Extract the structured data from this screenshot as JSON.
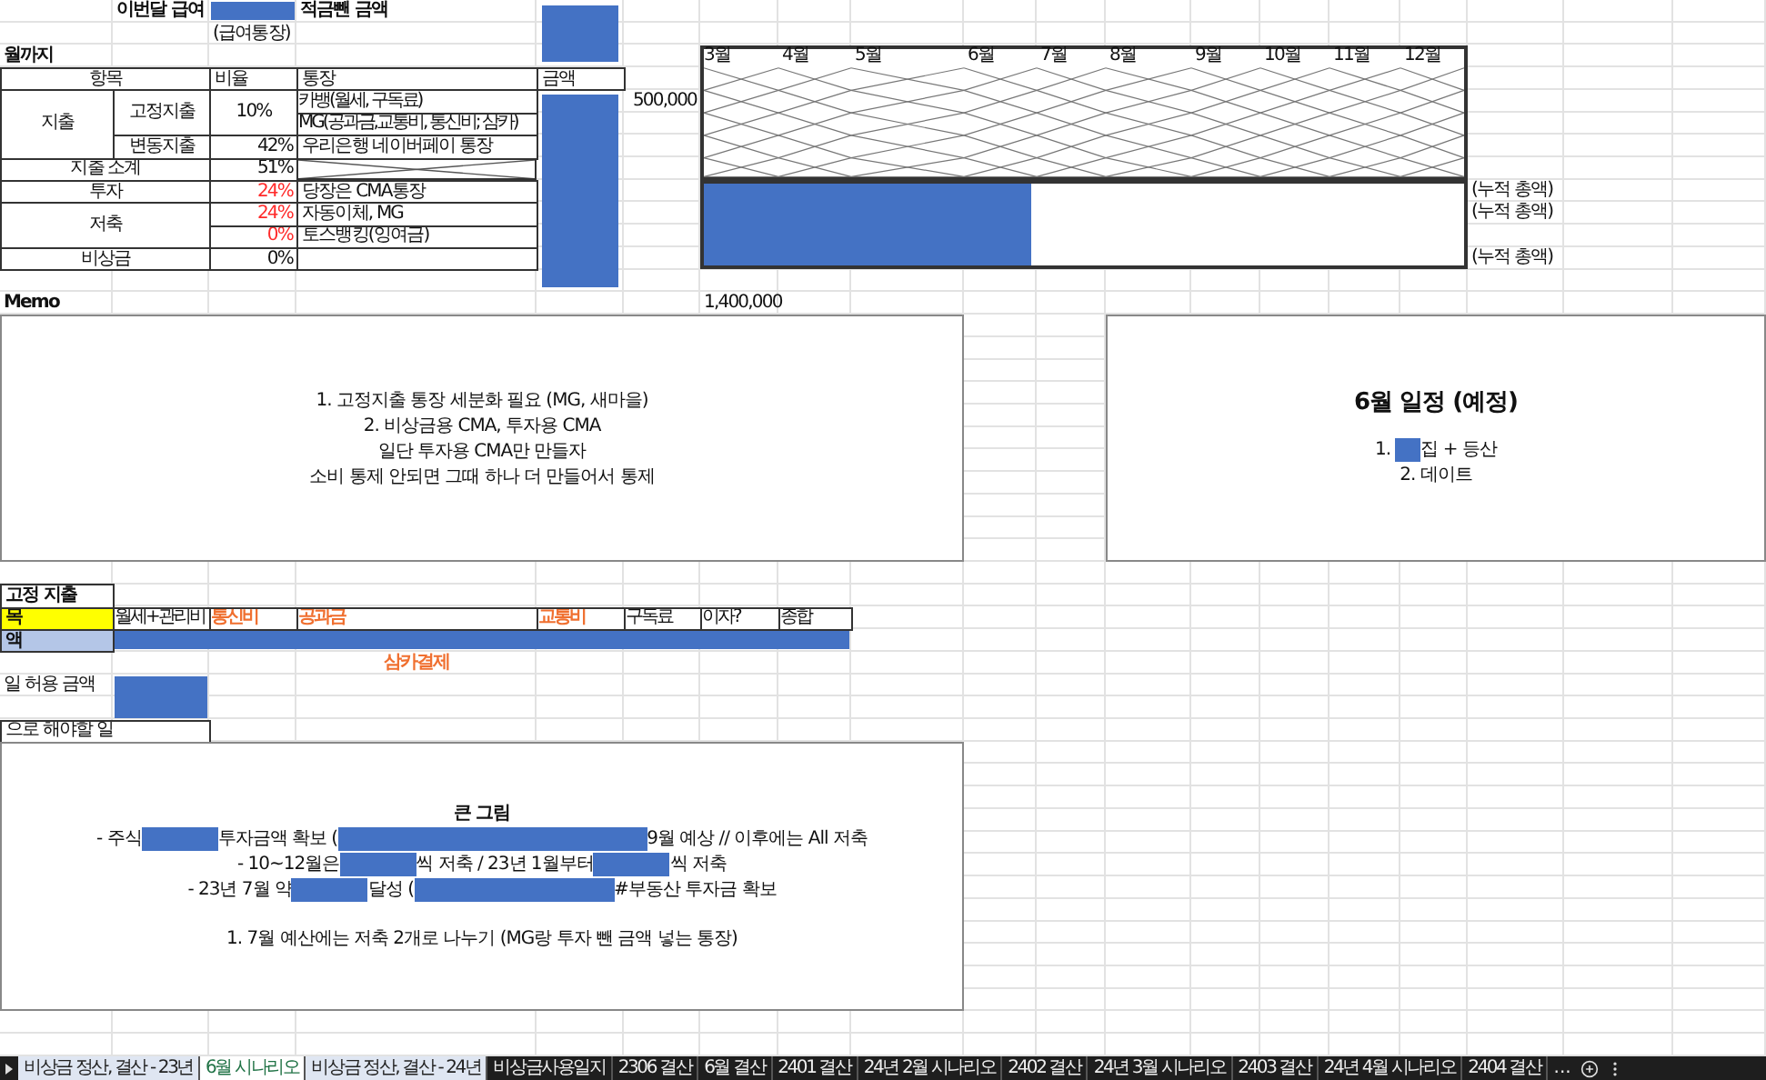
{
  "header": {
    "salary_label": "이번달 급여",
    "salary_note": "(급여통장)",
    "net_label": "적금뺀 금액"
  },
  "period_label": "월까지",
  "budget": {
    "columns": [
      "항목",
      "비율",
      "통장",
      "금액"
    ],
    "spending": {
      "label": "지출",
      "fixed": {
        "label": "고정지출",
        "ratio": "10%",
        "accounts": [
          "카뱅(월세, 구독료)",
          "MG(공과금,교통비, 통신비; 삼카)"
        ]
      },
      "variable": {
        "label": "변동지출",
        "ratio": "42%",
        "account": "우리은행 네이버페이 통장"
      }
    },
    "subtotal": {
      "label": "지출 소계",
      "ratio": "51%"
    },
    "invest": {
      "label": "투자",
      "ratio": "24%",
      "alert": true,
      "account": "당장은 CMA통장"
    },
    "savings": {
      "label": "저축",
      "entries": [
        {
          "ratio": "24%",
          "alert": true,
          "account": "자동이체, MG"
        },
        {
          "ratio": "0%",
          "alert": true,
          "account": "토스뱅킹(잉여금)"
        }
      ]
    },
    "emergency": {
      "label": "비상금",
      "ratio": "0%",
      "alert": false
    }
  },
  "side_amount": "500,000",
  "timeline": {
    "months": [
      "3월",
      "4월",
      "5월",
      "6월",
      "7월",
      "8월",
      "9월",
      "10월",
      "11월",
      "12월"
    ],
    "level": 0.43,
    "totals": [
      "(누적 총액)",
      "(누적 총액)",
      "(누적 총액)"
    ]
  },
  "total_amount": "1,400,000",
  "memo": {
    "title": "Memo",
    "lines": [
      "1. 고정지출 통장 세분화 필요 (MG, 새마을)",
      "2. 비상금용 CMA, 투자용 CMA",
      "일단 투자용 CMA만 만들자",
      "소비 통제 안되면 그때 하나 더 만들어서 통제"
    ]
  },
  "schedule": {
    "title": "6월 일정 (예정)",
    "items": [
      {
        "number": "1.",
        "redacted": true,
        "text": "집 + 등산"
      },
      {
        "number": "2.",
        "redacted": false,
        "text": "데이트"
      }
    ]
  },
  "fixed_costs": {
    "title": "고정 지출",
    "row_label": "목",
    "amount_label": "액",
    "columns": [
      {
        "label": "월세+관리비",
        "accent": false
      },
      {
        "label": "통신비",
        "accent": true
      },
      {
        "label": "공과금",
        "accent": true
      },
      {
        "label": "교통비",
        "accent": true
      },
      {
        "label": "구독료",
        "accent": false
      },
      {
        "label": "이자?",
        "accent": false
      },
      {
        "label": "종합",
        "accent": false
      }
    ],
    "note": "삼카결제"
  },
  "daily_allowance": {
    "label": "일 허용 금액"
  },
  "todo": {
    "label": "으로 해야할 일",
    "title": "큰 그림",
    "lines": [
      [
        {
          "kind": "text",
          "text": "- 주식 "
        },
        {
          "kind": "redacted"
        },
        {
          "kind": "text",
          "text": "투자금액 확보 ("
        },
        {
          "kind": "redacted_long"
        },
        {
          "kind": "text",
          "text": "9월 예상 // 이후에는 All 저축"
        }
      ],
      [
        {
          "kind": "text",
          "text": "- 10~12월은"
        },
        {
          "kind": "redacted"
        },
        {
          "kind": "text",
          "text": "씩 저축 / 23년 1월부터"
        },
        {
          "kind": "redacted"
        },
        {
          "kind": "text",
          "text": "씩 저축"
        }
      ],
      [
        {
          "kind": "text",
          "text": "- 23년 7월 약 "
        },
        {
          "kind": "redacted"
        },
        {
          "kind": "text",
          "text": "달성 ("
        },
        {
          "kind": "redacted_mid"
        },
        {
          "kind": "text",
          "text": "#부동산 투자금 확보"
        }
      ]
    ],
    "note": "1. 7월 예산에는 저축 2개로 나누기 (MG랑 투자 뺀 금액 넣는 통장)"
  },
  "sheet_tabs": [
    {
      "label": "비상금 정산, 결산 - 23년",
      "selected": false,
      "highlighted": true
    },
    {
      "label": "6월 시나리오",
      "selected": true,
      "highlighted": false
    },
    {
      "label": "비상금 정산, 결산 - 24년",
      "selected": false,
      "highlighted": true
    },
    {
      "label": "비상금사용일지",
      "selected": false,
      "highlighted": false
    },
    {
      "label": "2306 결산",
      "selected": false,
      "highlighted": false
    },
    {
      "label": "6월 결산",
      "selected": false,
      "highlighted": false
    },
    {
      "label": "2401 결산",
      "selected": false,
      "highlighted": false
    },
    {
      "label": "24년 2월 시나리오",
      "selected": false,
      "highlighted": false
    },
    {
      "label": "2402 결산",
      "selected": false,
      "highlighted": false
    },
    {
      "label": "24년 3월 시나리오",
      "selected": false,
      "highlighted": false
    },
    {
      "label": "2403 결산",
      "selected": false,
      "highlighted": false
    },
    {
      "label": "24년 4월 시나리오",
      "selected": false,
      "highlighted": false
    },
    {
      "label": "2404 결산",
      "selected": false,
      "highlighted": false
    }
  ],
  "more_tabs": "..."
}
